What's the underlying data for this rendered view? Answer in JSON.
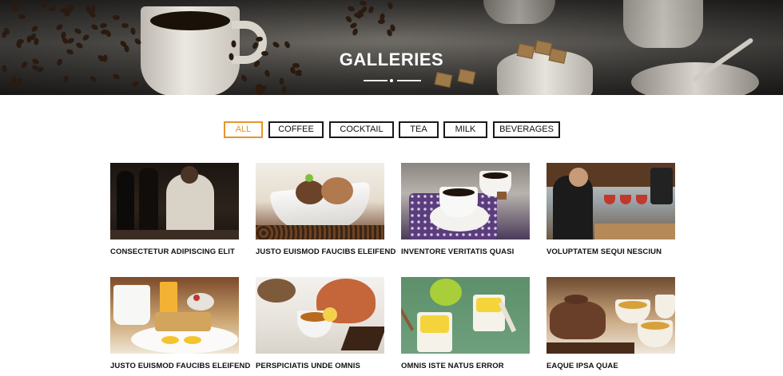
{
  "hero": {
    "title": "GALLERIES",
    "background_icon": "coffee-cups-and-beans-photo"
  },
  "filters": [
    {
      "label": "ALL",
      "active": true
    },
    {
      "label": "COFFEE",
      "active": false
    },
    {
      "label": "COCKTAIL",
      "active": false
    },
    {
      "label": "TEA",
      "active": false
    },
    {
      "label": "MILK",
      "active": false
    },
    {
      "label": "BEVERAGES",
      "active": false
    }
  ],
  "gallery": [
    {
      "caption": "CONSECTETUR ADIPISCING ELIT",
      "image": "barista-event-photo"
    },
    {
      "caption": "JUSTO EUISMOD FAUCIBS ELEIFEND",
      "image": "ice-cream-with-coffee-beans-photo"
    },
    {
      "caption": "INVENTORE VERITATIS QUASI",
      "image": "coffee-cups-on-tray-photo"
    },
    {
      "caption": "VOLUPTATEM SEQUI NESCIUN",
      "image": "barista-pour-over-photo"
    },
    {
      "caption": "JUSTO EUISMOD FAUCIBS ELEIFEND",
      "image": "breakfast-sandwich-photo"
    },
    {
      "caption": "PERSPICIATIS UNDE OMNIS",
      "image": "teapot-and-dessert-photo"
    },
    {
      "caption": "OMNIS ISTE NATUS ERROR",
      "image": "lemon-drinks-photo"
    },
    {
      "caption": "EAQUE IPSA QUAE",
      "image": "clay-teapot-and-tea-cups-photo"
    }
  ],
  "colors": {
    "accent": "#e3962e",
    "border": "#1a1a1a",
    "text": "#111111"
  }
}
